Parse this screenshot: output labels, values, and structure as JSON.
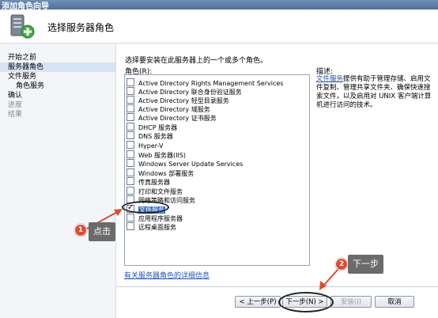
{
  "window": {
    "title": "添加角色向导"
  },
  "header": {
    "title": "选择服务器角色",
    "icon": "server-wizard-icon"
  },
  "nav": {
    "items": [
      {
        "label": "开始之前",
        "state": "normal"
      },
      {
        "label": "服务器角色",
        "state": "selected"
      },
      {
        "label": "文件服务",
        "state": "normal"
      },
      {
        "label": "角色服务",
        "state": "sub"
      },
      {
        "label": "确认",
        "state": "normal"
      },
      {
        "label": "进度",
        "state": "disabled"
      },
      {
        "label": "结果",
        "state": "disabled"
      }
    ]
  },
  "main": {
    "intro": "选择要安装在此服务器上的一个或多个角色。",
    "roles_label": "角色(R):",
    "roles": [
      {
        "label": "Active Directory Rights Management Services",
        "checked": false
      },
      {
        "label": "Active Directory 联合身份验证服务",
        "checked": false
      },
      {
        "label": "Active Directory 轻型目录服务",
        "checked": false
      },
      {
        "label": "Active Directory 域服务",
        "checked": false
      },
      {
        "label": "Active Directory 证书服务",
        "checked": false
      },
      {
        "label": "DHCP 服务器",
        "checked": false
      },
      {
        "label": "DNS 服务器",
        "checked": false
      },
      {
        "label": "Hyper-V",
        "checked": false
      },
      {
        "label": "Web 服务器(IIS)",
        "checked": false
      },
      {
        "label": "Windows Server Update Services",
        "checked": false
      },
      {
        "label": "Windows 部署服务",
        "checked": false
      },
      {
        "label": "传真服务器",
        "checked": false
      },
      {
        "label": "打印和文件服务",
        "checked": false
      },
      {
        "label": "网络策略和访问服务",
        "checked": false
      },
      {
        "label": "文件服务",
        "checked": true
      },
      {
        "label": "应用程序服务器",
        "checked": false
      },
      {
        "label": "远程桌面服务",
        "checked": false
      }
    ],
    "more_link": "有关服务器角色的详细信息"
  },
  "description": {
    "label": "描述:",
    "link": "文件服务",
    "text": "提供有助于管理存储、启用文件复制、管理共享文件夹、确保快速搜索文件，以及启用对 UNIX 客户端计算机进行访问的技术。"
  },
  "buttons": {
    "prev": "< 上一步(P)",
    "next": "下一步(N) >",
    "install": "安装(I)",
    "cancel": "取消"
  },
  "annotations": [
    {
      "number": "1",
      "label": "点击"
    },
    {
      "number": "2",
      "label": "下一步"
    }
  ],
  "colors": {
    "highlight": "#316ac5",
    "marker": "#e14b2d",
    "callout": "#6b6b6b"
  }
}
